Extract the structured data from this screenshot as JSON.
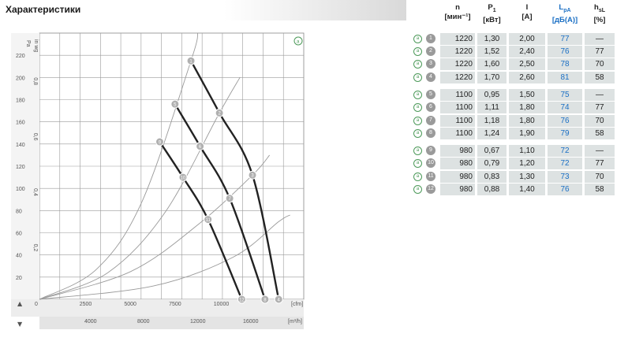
{
  "title": "Характеристики",
  "table": {
    "headers": [
      {
        "line1": "n",
        "line2": "[мин⁻¹]",
        "sub": ""
      },
      {
        "line1": "P",
        "sub": "1",
        "line2": "[кВт]"
      },
      {
        "line1": "I",
        "sub": "",
        "line2": "[A]"
      },
      {
        "line1": "L",
        "sub": "pA",
        "line2": "[дБ(A)]"
      },
      {
        "line1": "h",
        "sub": "sL",
        "line2": "[%]"
      }
    ],
    "rows": [
      {
        "id": "1",
        "n": "1220",
        "p": "1,30",
        "i": "2,00",
        "lp": "77",
        "h": "—"
      },
      {
        "id": "2",
        "n": "1220",
        "p": "1,52",
        "i": "2,40",
        "lp": "76",
        "h": "77"
      },
      {
        "id": "3",
        "n": "1220",
        "p": "1,60",
        "i": "2,50",
        "lp": "78",
        "h": "70"
      },
      {
        "id": "4",
        "n": "1220",
        "p": "1,70",
        "i": "2,60",
        "lp": "81",
        "h": "58"
      },
      {
        "id": "5",
        "n": "1100",
        "p": "0,95",
        "i": "1,50",
        "lp": "75",
        "h": "—"
      },
      {
        "id": "6",
        "n": "1100",
        "p": "1,11",
        "i": "1,80",
        "lp": "74",
        "h": "77"
      },
      {
        "id": "7",
        "n": "1100",
        "p": "1,18",
        "i": "1,80",
        "lp": "76",
        "h": "70"
      },
      {
        "id": "8",
        "n": "1100",
        "p": "1,24",
        "i": "1,90",
        "lp": "79",
        "h": "58"
      },
      {
        "id": "9",
        "n": "980",
        "p": "0,67",
        "i": "1,10",
        "lp": "72",
        "h": "—"
      },
      {
        "id": "10",
        "n": "980",
        "p": "0,79",
        "i": "1,20",
        "lp": "72",
        "h": "77"
      },
      {
        "id": "11",
        "n": "980",
        "p": "0,83",
        "i": "1,30",
        "lp": "73",
        "h": "70"
      },
      {
        "id": "12",
        "n": "980",
        "p": "0,88",
        "i": "1,40",
        "lp": "76",
        "h": "58"
      }
    ],
    "bullet_symbol": "a"
  },
  "chart_data": {
    "type": "line",
    "x_unit_top": "[cfm]",
    "x_unit_bottom": "[m³/h]",
    "y_unit_left": "in wg",
    "y_unit_right": "Pa",
    "x_ticks_top": [
      "0",
      "2500",
      "5000",
      "7500",
      "10000"
    ],
    "x_ticks_bottom": [
      "4000",
      "8000",
      "12000",
      "16000"
    ],
    "y_ticks_left": [
      "20",
      "40",
      "60",
      "80",
      "100",
      "120",
      "140",
      "160",
      "180",
      "200",
      "220"
    ],
    "y_ticks_right": [
      "0,2",
      "0,4",
      "0,6",
      "0,8"
    ],
    "corner_badge": "a",
    "xlim": [
      0,
      11600
    ],
    "ylim": [
      0,
      240
    ],
    "series": [
      {
        "name": "1220",
        "x": [
          6650,
          7900,
          9350,
          10500
        ],
        "y": [
          215,
          168,
          112,
          0
        ]
      },
      {
        "name": "1100",
        "x": [
          5950,
          7050,
          8350,
          9900
        ],
        "y": [
          176,
          138,
          91,
          0
        ]
      },
      {
        "name": "980",
        "x": [
          5280,
          6300,
          7400,
          8880
        ],
        "y": [
          142,
          110,
          72,
          0
        ]
      }
    ],
    "efficiency_curves": [
      {
        "name": "1",
        "x": [
          0,
          2500,
          4500,
          6650,
          6950
        ],
        "y": [
          0,
          27,
          88,
          215,
          240
        ]
      },
      {
        "name": "2",
        "x": [
          0,
          3000,
          5500,
          7900,
          8800
        ],
        "y": [
          0,
          24,
          78,
          168,
          200
        ]
      },
      {
        "name": "3",
        "x": [
          0,
          4000,
          7000,
          9350,
          10100
        ],
        "y": [
          0,
          25,
          68,
          112,
          130
        ]
      },
      {
        "name": "4",
        "x": [
          0,
          5000,
          8500,
          10500,
          11000
        ],
        "y": [
          0,
          12,
          38,
          70,
          76
        ]
      }
    ],
    "markers": [
      {
        "label": "1",
        "x": 6650,
        "y": 215
      },
      {
        "label": "2",
        "x": 7900,
        "y": 168
      },
      {
        "label": "3",
        "x": 9350,
        "y": 112
      },
      {
        "label": "4",
        "x": 10500,
        "y": 0
      },
      {
        "label": "5",
        "x": 5950,
        "y": 176
      },
      {
        "label": "6",
        "x": 7050,
        "y": 138
      },
      {
        "label": "7",
        "x": 8350,
        "y": 91
      },
      {
        "label": "8",
        "x": 9900,
        "y": 0
      },
      {
        "label": "9",
        "x": 5280,
        "y": 142
      },
      {
        "label": "10",
        "x": 6300,
        "y": 110
      },
      {
        "label": "11",
        "x": 7400,
        "y": 72
      },
      {
        "label": "12",
        "x": 8880,
        "y": 0
      }
    ],
    "colors": {
      "curve": "#222222",
      "efficiency": "#9a9a9a",
      "marker": "#b0b0b0",
      "grid": "#9a9a9a"
    }
  }
}
